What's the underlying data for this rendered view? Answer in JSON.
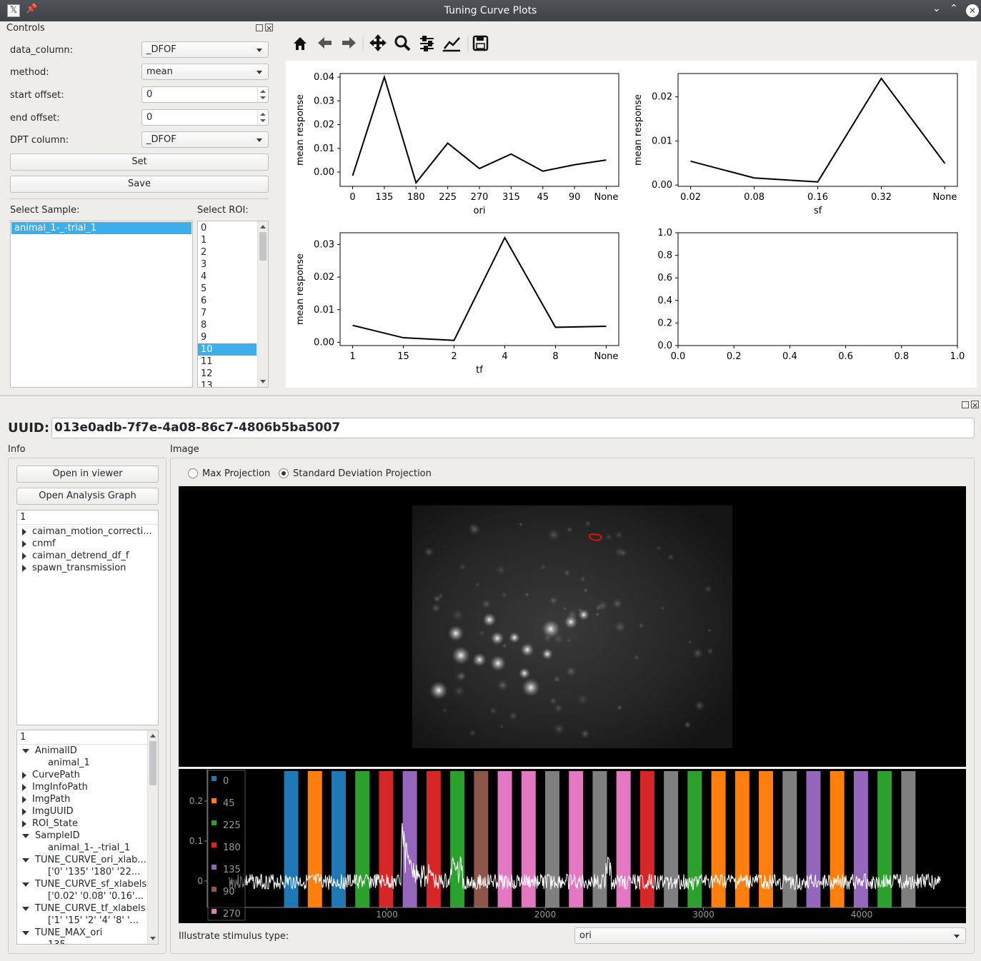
{
  "window": {
    "title": "Tuning Curve Plots"
  },
  "controls": {
    "dock_title": "Controls",
    "data_column_label": "data_column:",
    "data_column_value": "_DFOF",
    "method_label": "method:",
    "method_value": "mean",
    "start_offset_label": "start offset:",
    "start_offset_value": "0",
    "end_offset_label": "end offset:",
    "end_offset_value": "0",
    "dpt_column_label": "DPT column:",
    "dpt_column_value": "_DFOF",
    "set_button": "Set",
    "save_button": "Save",
    "select_sample_label": "Select Sample:",
    "samples": [
      "animal_1-_-trial_1"
    ],
    "select_roi_label": "Select ROI:",
    "rois": [
      "0",
      "1",
      "2",
      "3",
      "4",
      "5",
      "6",
      "7",
      "8",
      "9",
      "10",
      "11",
      "12",
      "13"
    ],
    "selected_roi": "10"
  },
  "toolbar": {
    "icons": [
      "home-icon",
      "back-arrow-icon",
      "forward-arrow-icon",
      "pan-icon",
      "zoom-icon",
      "subplots-config-icon",
      "edit-axis-icon",
      "save-figure-icon"
    ]
  },
  "chart_data": [
    {
      "type": "line",
      "x": [
        "0",
        "135",
        "180",
        "225",
        "270",
        "315",
        "45",
        "90",
        "None"
      ],
      "y": [
        -0.0015,
        0.04,
        -0.0045,
        0.0122,
        0.0015,
        0.0076,
        0.0004,
        0.0031,
        0.0051
      ],
      "xlabel": "ori",
      "ylabel": "mean response",
      "yticks": [
        "0.00",
        "0.01",
        "0.02",
        "0.03",
        "0.04"
      ],
      "ylim": [
        -0.006,
        0.0415
      ]
    },
    {
      "type": "line",
      "x": [
        "0.02",
        "0.08",
        "0.16",
        "0.32",
        "None"
      ],
      "y": [
        0.0054,
        0.0016,
        0.0007,
        0.0242,
        0.0049
      ],
      "xlabel": "sf",
      "ylabel": "mean response",
      "yticks": [
        "0.00",
        "0.01",
        "0.02"
      ],
      "ylim": [
        -0.0003,
        0.0253
      ]
    },
    {
      "type": "line",
      "x": [
        "1",
        "15",
        "2",
        "4",
        "8",
        "None"
      ],
      "y": [
        0.0052,
        0.0014,
        0.0006,
        0.0321,
        0.0046,
        0.0049
      ],
      "xlabel": "tf",
      "ylabel": "mean response",
      "yticks": [
        "0.00",
        "0.01",
        "0.02",
        "0.03"
      ],
      "ylim": [
        -0.001,
        0.0336
      ]
    },
    {
      "type": "line",
      "x": [],
      "y": [],
      "xticks": [
        "0.0",
        "0.2",
        "0.4",
        "0.6",
        "0.8",
        "1.0"
      ],
      "yticks": [
        "0.0",
        "0.2",
        "0.4",
        "0.6",
        "0.8",
        "1.0"
      ],
      "xlim": [
        0,
        1
      ],
      "ylim": [
        0,
        1
      ]
    }
  ],
  "viewer": {
    "uuid_label": "UUID:",
    "uuid_value": "013e0adb-7f7e-4a08-86c7-4806b5ba5007",
    "info_label": "Info",
    "image_label": "Image",
    "open_viewer_button": "Open in viewer",
    "open_graph_button": "Open Analysis Graph",
    "tree1_header": "1",
    "tree1_items": [
      "caiman_motion_correcti...",
      "cnmf",
      "caiman_detrend_df_f",
      "spawn_transmission"
    ],
    "tree2_header": "1",
    "tree2_items": [
      {
        "label": "AnimalID",
        "expanded": true
      },
      {
        "label": "animal_1",
        "child": true
      },
      {
        "label": "CurvePath",
        "expanded": false
      },
      {
        "label": "ImgInfoPath",
        "expanded": false
      },
      {
        "label": "ImgPath",
        "expanded": false
      },
      {
        "label": "ImgUUID",
        "expanded": false
      },
      {
        "label": "ROI_State",
        "expanded": false
      },
      {
        "label": "SampleID",
        "expanded": true
      },
      {
        "label": "animal_1-_-trial_1",
        "child": true
      },
      {
        "label": "TUNE_CURVE_ori_xlab...",
        "expanded": true
      },
      {
        "label": "['0' '135' '180' '22...",
        "child": true
      },
      {
        "label": "TUNE_CURVE_sf_xlabels",
        "expanded": true
      },
      {
        "label": "['0.02' '0.08' '0.16'...",
        "child": true
      },
      {
        "label": "TUNE_CURVE_tf_xlabels",
        "expanded": true
      },
      {
        "label": "['1' '15' '2' '4' '8' '...",
        "child": true
      },
      {
        "label": "TUNE_MAX_ori",
        "expanded": true
      },
      {
        "label": "135",
        "child": true
      }
    ],
    "max_projection_label": "Max Projection",
    "std_projection_label": "Standard Deviation Projection",
    "selected_projection": "std",
    "illustrate_label": "Illustrate stimulus type:",
    "illustrate_value": "ori"
  },
  "trace_plot": {
    "yticks": [
      "0.2",
      "0.1",
      "0"
    ],
    "xticks": [
      "1000",
      "2000",
      "3000",
      "4000"
    ],
    "legend": [
      {
        "label": "0",
        "color": "#1f77b4"
      },
      {
        "label": "45",
        "color": "#ff7f0e"
      },
      {
        "label": "225",
        "color": "#2ca02c"
      },
      {
        "label": "180",
        "color": "#d62728"
      },
      {
        "label": "135",
        "color": "#9467bd"
      },
      {
        "label": "90",
        "color": "#8c564b"
      },
      {
        "label": "270",
        "color": "#e377c2"
      }
    ],
    "stimulus_bars": [
      {
        "start": 350,
        "color": "#1f77b4"
      },
      {
        "start": 500,
        "color": "#ff7f0e"
      },
      {
        "start": 650,
        "color": "#1f77b4"
      },
      {
        "start": 800,
        "color": "#2ca02c"
      },
      {
        "start": 950,
        "color": "#d62728"
      },
      {
        "start": 1100,
        "color": "#9467bd"
      },
      {
        "start": 1250,
        "color": "#d62728"
      },
      {
        "start": 1400,
        "color": "#2ca02c"
      },
      {
        "start": 1550,
        "color": "#8c564b"
      },
      {
        "start": 1700,
        "color": "#e377c2"
      },
      {
        "start": 1850,
        "color": "#e377c2"
      },
      {
        "start": 2000,
        "color": "#7f7f7f"
      },
      {
        "start": 2150,
        "color": "#e377c2"
      },
      {
        "start": 2300,
        "color": "#7f7f7f"
      },
      {
        "start": 2450,
        "color": "#e377c2"
      },
      {
        "start": 2600,
        "color": "#d62728"
      },
      {
        "start": 2750,
        "color": "#7f7f7f"
      },
      {
        "start": 2900,
        "color": "#2ca02c"
      },
      {
        "start": 3050,
        "color": "#ff7f0e"
      },
      {
        "start": 3200,
        "color": "#ff7f0e"
      },
      {
        "start": 3350,
        "color": "#ff7f0e"
      },
      {
        "start": 3500,
        "color": "#7f7f7f"
      },
      {
        "start": 3650,
        "color": "#9467bd"
      },
      {
        "start": 3800,
        "color": "#ff7f0e"
      },
      {
        "start": 3950,
        "color": "#9467bd"
      },
      {
        "start": 4100,
        "color": "#2ca02c"
      },
      {
        "start": 4250,
        "color": "#7f7f7f"
      }
    ]
  }
}
